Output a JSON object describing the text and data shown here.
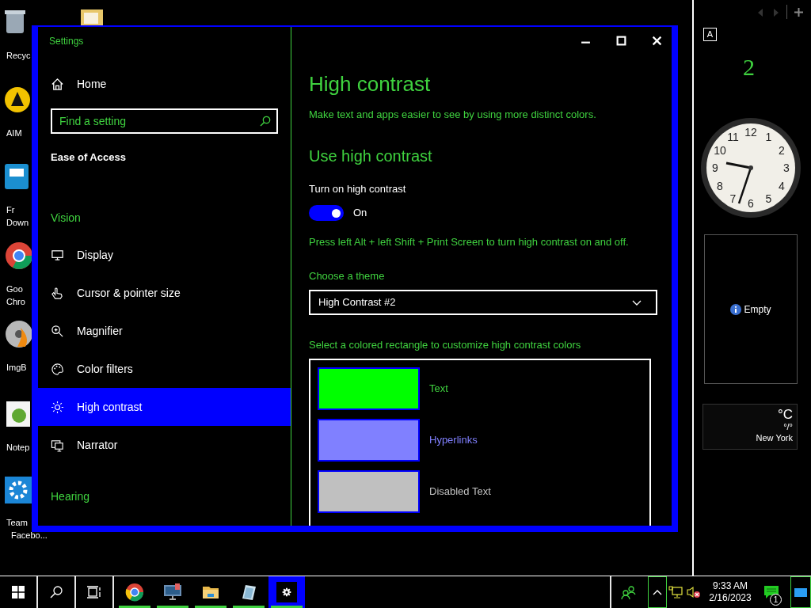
{
  "desktop_icons": [
    {
      "lines": [
        "Recyc"
      ]
    },
    {
      "lines": [
        "AIM"
      ]
    },
    {
      "lines": [
        "Fr",
        "Down"
      ]
    },
    {
      "lines": [
        "Goo",
        "Chro"
      ]
    },
    {
      "lines": [
        "ImgB"
      ]
    },
    {
      "lines": [
        "Notep"
      ]
    },
    {
      "lines": [
        "Team",
        "Facebo..."
      ]
    }
  ],
  "window": {
    "title": "Settings"
  },
  "sidebar": {
    "home": "Home",
    "search": {
      "placeholder": "Find a setting"
    },
    "section": "Ease of Access",
    "groups": [
      {
        "heading": "Vision",
        "items": [
          {
            "label": "Display",
            "selected": false
          },
          {
            "label": "Cursor & pointer size",
            "selected": false
          },
          {
            "label": "Magnifier",
            "selected": false
          },
          {
            "label": "Color filters",
            "selected": false
          },
          {
            "label": "High contrast",
            "selected": true
          },
          {
            "label": "Narrator",
            "selected": false
          }
        ]
      },
      {
        "heading": "Hearing"
      }
    ]
  },
  "content": {
    "title": "High contrast",
    "description": "Make text and apps easier to see by using more distinct colors.",
    "section": "Use high contrast",
    "toggle": {
      "label": "Turn on high contrast",
      "on": true,
      "state_text": "On"
    },
    "hint": "Press left Alt + left Shift + Print Screen to turn high contrast on and off.",
    "theme": {
      "label": "Choose a theme",
      "value": "High Contrast #2"
    },
    "colors_intro": "Select a colored rectangle to customize high contrast colors",
    "swatches": [
      {
        "label": "Text",
        "color": "#00ff00"
      },
      {
        "label": "Hyperlinks",
        "color": "#8080ff"
      },
      {
        "label": "Disabled Text",
        "color": "#c0c0c0"
      }
    ]
  },
  "gadgets": {
    "letter": "A",
    "page": "2",
    "clock_numerals": [
      "11",
      "12",
      "1",
      "10",
      "2",
      "9",
      "3",
      "8",
      "4",
      "7",
      "6",
      "5"
    ],
    "slideshow": "Empty",
    "weather": {
      "unit": "°C",
      "range": "°/°",
      "city": "New York"
    }
  },
  "taskbar": {
    "apps": [
      {
        "running": true,
        "selected": false
      },
      {
        "running": true,
        "selected": false
      },
      {
        "running": true,
        "selected": false
      },
      {
        "running": true,
        "selected": false
      },
      {
        "running": true,
        "selected": true
      }
    ],
    "time": "9:33 AM",
    "date": "2/16/2023",
    "notifications": "1"
  }
}
